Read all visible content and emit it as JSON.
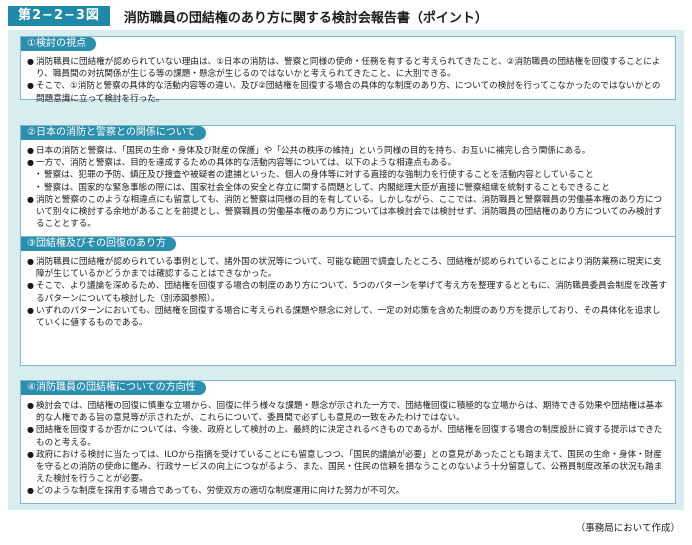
{
  "header": {
    "figure_label": "第2−2−3図",
    "title": "消防職員の団結権のあり方に関する検討会報告書（ポイント）"
  },
  "sections": [
    {
      "heading": "①検討の視点",
      "paragraphs": [
        {
          "kind": "bullet",
          "text": "消防職員に団結権が認められていない理由は、①日本の消防は、警察と同様の使命・任務を有すると考えられてきたこと、②消防職員の団結権を回復することにより、職員間の対抗関係が生じる等の課題・懸念が生じるのではないかと考えられてきたこと、に大別できる。"
        },
        {
          "kind": "bullet",
          "text": "そこで、①消防と警察の具体的な活動内容等の違い、及び②団結権を回復する場合の具体的な制度のあり方、についての検討を行ってこなかったのではないかとの問題意識に立って検討を行った。"
        }
      ]
    },
    {
      "heading": "②日本の消防と警察との関係について",
      "paragraphs": [
        {
          "kind": "bullet",
          "text": "日本の消防と警察は、「国民の生命・身体及び財産の保護」や「公共の秩序の維持」という同様の目的を持ち、お互いに補完し合う関係にある。"
        },
        {
          "kind": "bullet",
          "text": "一方で、消防と警察は、目的を達成するための具体的な活動内容等については、以下のような相違点もある。"
        },
        {
          "kind": "sub",
          "text": "警察は、犯罪の予防、鎮圧及び捜査や被疑者の逮捕といった、個人の身体等に対する直接的な強制力を行使することを活動内容としていること"
        },
        {
          "kind": "sub",
          "text": "警察は、国家的な緊急事態の際には、国家社会全体の安全と存立に関する問題として、内閣総理大臣が直接に警察組織を統制することもできること"
        },
        {
          "kind": "bullet",
          "text": "消防と警察のこのような相違点にも留意しても、消防と警察は同様の目的を有している。しかしながら、ここでは、消防職員と警察職員の労働基本権のあり方について別々に検討する余地があることを前提とし、警察職員の労働基本権のあり方については本検討会では検討せず、消防職員の団結権のあり方についてのみ検討することとする。"
        }
      ]
    },
    {
      "heading": "③団結権及びその回復のあり方",
      "paragraphs": [
        {
          "kind": "bullet",
          "text": "消防職員に団結権が認められている事例として、諸外国の状況等について、可能な範囲で調査したところ、団結権が認められていることにより消防業務に現実に支障が生じているかどうかまでは確認することはできなかった。"
        },
        {
          "kind": "bullet",
          "text": "そこで、より議論を深めるため、団結権を回復する場合の制度のあり方について、5つのパターンを挙げて考え方を整理するとともに、消防職員委員会制度を改善するパターンについても検討した（別添図参照）。"
        },
        {
          "kind": "bullet",
          "text": "いずれのパターンにおいても、団結権を回復する場合に考えられる課題や懸念に対して、一定の対応策を含めた制度のあり方を提示しており、その具体化を追求していくに値するものである。"
        }
      ]
    },
    {
      "heading": "④消防職員の団結権についての方向性",
      "paragraphs": [
        {
          "kind": "bullet",
          "text": "検討会では、団結権の回復に慎重な立場から、回復に伴う様々な課題・懸念が示された一方で、団結権回復に積極的な立場からは、期待できる効果や団結権は基本的な人権である旨の意見等が示されたが、これらについて、委員間で必ずしも意見の一致をみたわけではない。"
        },
        {
          "kind": "bullet",
          "text": "団結権を回復するか否かについては、今後、政府として検討の上、最終的に決定されるべきものであるが、団結権を回復する場合の制度設計に資する提示はできたものと考える。"
        },
        {
          "kind": "bullet",
          "text": "政府における検討に当たっては、ILOから指摘を受けていることにも留意しつつ、「国民的議論が必要」との意見があったことも踏まえて、国民の生命・身体・財産を守るとの消防の使命に鑑み、行政サービスの向上につながるよう、また、国民・住民の信頼を損なうことのないよう十分留意して、公務員制度改革の状況も踏まえた検討を行うことが必要。"
        },
        {
          "kind": "bullet",
          "text": "どのような制度を採用する場合であっても、労使双方の適切な制度運用に向けた努力が不可欠。"
        }
      ]
    }
  ],
  "footer": {
    "source": "（事務局において作成）"
  }
}
